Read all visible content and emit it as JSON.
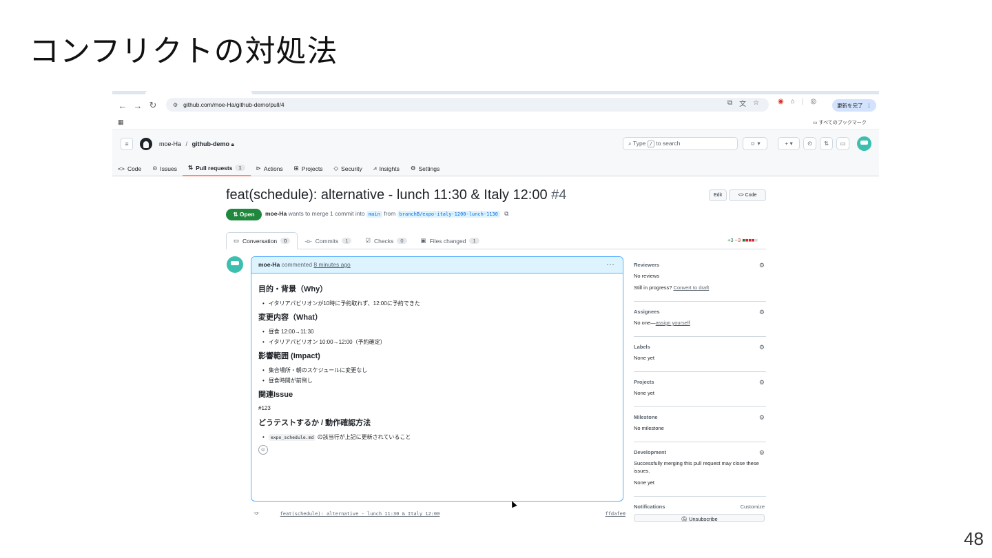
{
  "slide": {
    "title": "コンフリクトの対処法",
    "page_number": "48"
  },
  "browser": {
    "url": "github.com/moe-Ha/github-demo/pull/4",
    "update_button": "更新を完了",
    "bookmarks_folder": "すべてのブックマーク"
  },
  "github": {
    "owner": "moe-Ha",
    "repo": "github-demo",
    "search_placeholder_pre": "Type",
    "search_key": "/",
    "search_placeholder_post": "to search",
    "nav": [
      {
        "label": "Code",
        "icon": "code-icon"
      },
      {
        "label": "Issues",
        "icon": "issue-icon"
      },
      {
        "label": "Pull requests",
        "count": "1",
        "icon": "pull-request-icon"
      },
      {
        "label": "Actions",
        "icon": "play-icon"
      },
      {
        "label": "Projects",
        "icon": "table-icon"
      },
      {
        "label": "Security",
        "icon": "shield-icon"
      },
      {
        "label": "Insights",
        "icon": "graph-icon"
      },
      {
        "label": "Settings",
        "icon": "gear-icon"
      }
    ]
  },
  "pr": {
    "title": "feat(schedule): alternative - lunch 11:30 & Italy 12:00",
    "number": "#4",
    "edit_label": "Edit",
    "code_label": "<> Code",
    "state": "Open",
    "author": "moe-Ha",
    "merge_text": "wants to merge 1 commit into",
    "base_branch": "main",
    "from_text": "from",
    "head_branch": "branchB/expo-italy-1200-lunch-1130",
    "tabs": [
      {
        "label": "Conversation",
        "count": "0"
      },
      {
        "label": "Commits",
        "count": "1"
      },
      {
        "label": "Checks",
        "count": "0"
      },
      {
        "label": "Files changed",
        "count": "1"
      }
    ],
    "diffstat_add": "+3",
    "diffstat_del": "−3"
  },
  "comment": {
    "author": "moe-Ha",
    "action": "commented",
    "time": "8 minutes ago",
    "sections": {
      "why_heading": "目的・背景（Why）",
      "why_items": [
        "イタリアパビリオンが10時に予約取れず、12:00に予約できた"
      ],
      "what_heading": "変更内容（What）",
      "what_items": [
        "昼食 12:00→11:30",
        "イタリアパビリオン 10:00→12:00（予約確定）"
      ],
      "impact_heading": "影響範囲 (Impact)",
      "impact_items": [
        "集合場所・朝のスケジュールに変更なし",
        "昼食時間が前倒し"
      ],
      "issue_heading": "関連Issue",
      "issue_ref": "#123",
      "test_heading": "どうテストするか / 動作確認方法",
      "test_code": "expo_schedule.md",
      "test_text": "の該当行が上記に更新されていること"
    }
  },
  "commit": {
    "message": "feat(schedule): alternative - lunch 11:30 & Italy 12:00",
    "sha": "ffdafe0"
  },
  "sidebar": {
    "reviewers_label": "Reviewers",
    "reviewers_value": "No reviews",
    "in_progress": "Still in progress?",
    "convert_link": "Convert to draft",
    "assignees_label": "Assignees",
    "assignees_value": "No one—",
    "assign_link": "assign yourself",
    "labels_label": "Labels",
    "labels_value": "None yet",
    "projects_label": "Projects",
    "projects_value": "None yet",
    "milestone_label": "Milestone",
    "milestone_value": "No milestone",
    "development_label": "Development",
    "development_text": "Successfully merging this pull request may close these issues.",
    "development_value": "None yet",
    "notifications_label": "Notifications",
    "customize": "Customize",
    "unsubscribe": "Unsubscribe"
  },
  "colors": {
    "open_green": "#1f883d",
    "accent_blue": "#0969da",
    "nav_underline": "#fd8c73",
    "avatar_teal": "#3dbfb0"
  }
}
